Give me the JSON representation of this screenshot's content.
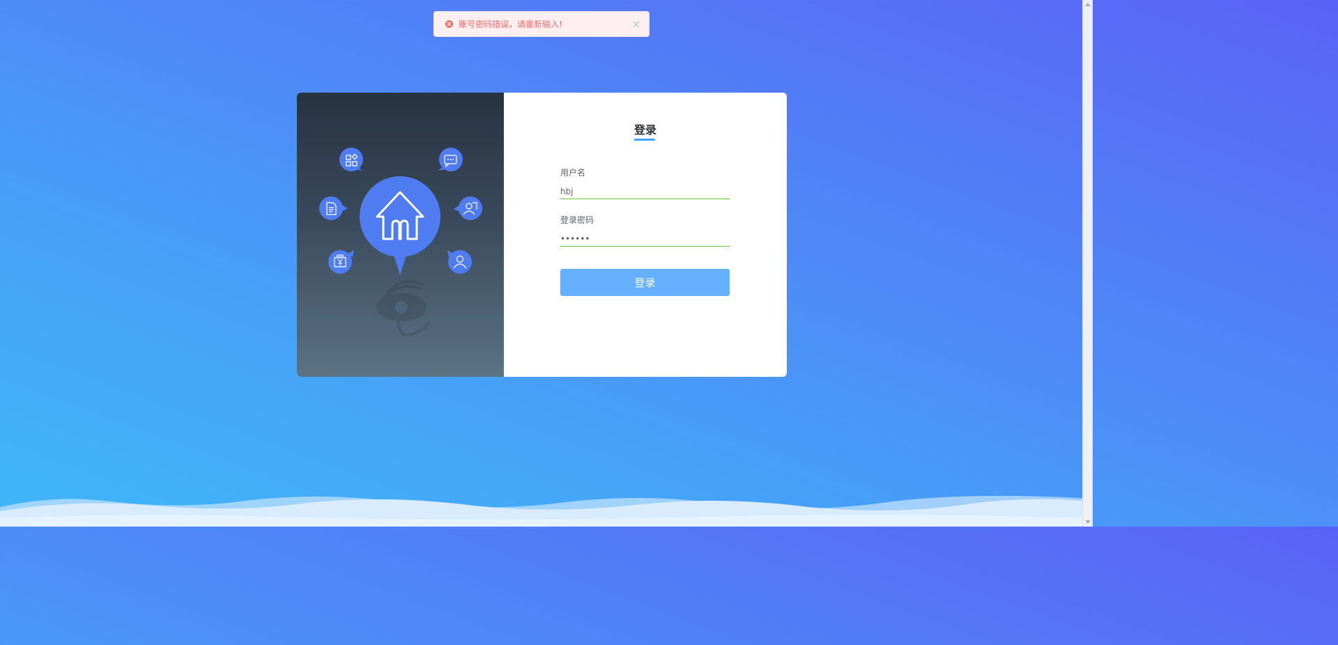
{
  "toast": {
    "type": "error",
    "message": "账号密码错误，请重新输入!",
    "color": "#f56c6c"
  },
  "login": {
    "title": "登录",
    "username_label": "用户名",
    "username_value": "hbj",
    "password_label": "登录密码",
    "password_value": "••••••",
    "submit_label": "登录"
  },
  "illustration": {
    "center_icon": "home-icon",
    "bubble_icons": [
      "apps-icon",
      "chat-icon",
      "document-icon",
      "user-card-icon",
      "yuan-wallet-icon",
      "user-icon"
    ],
    "watermark": "eye-logo"
  },
  "colors": {
    "accent": "#409eff",
    "button": "#66b1ff",
    "bubble": "#4f7cf1",
    "input_border": "#67c23a",
    "panel_dark": "#283341"
  }
}
